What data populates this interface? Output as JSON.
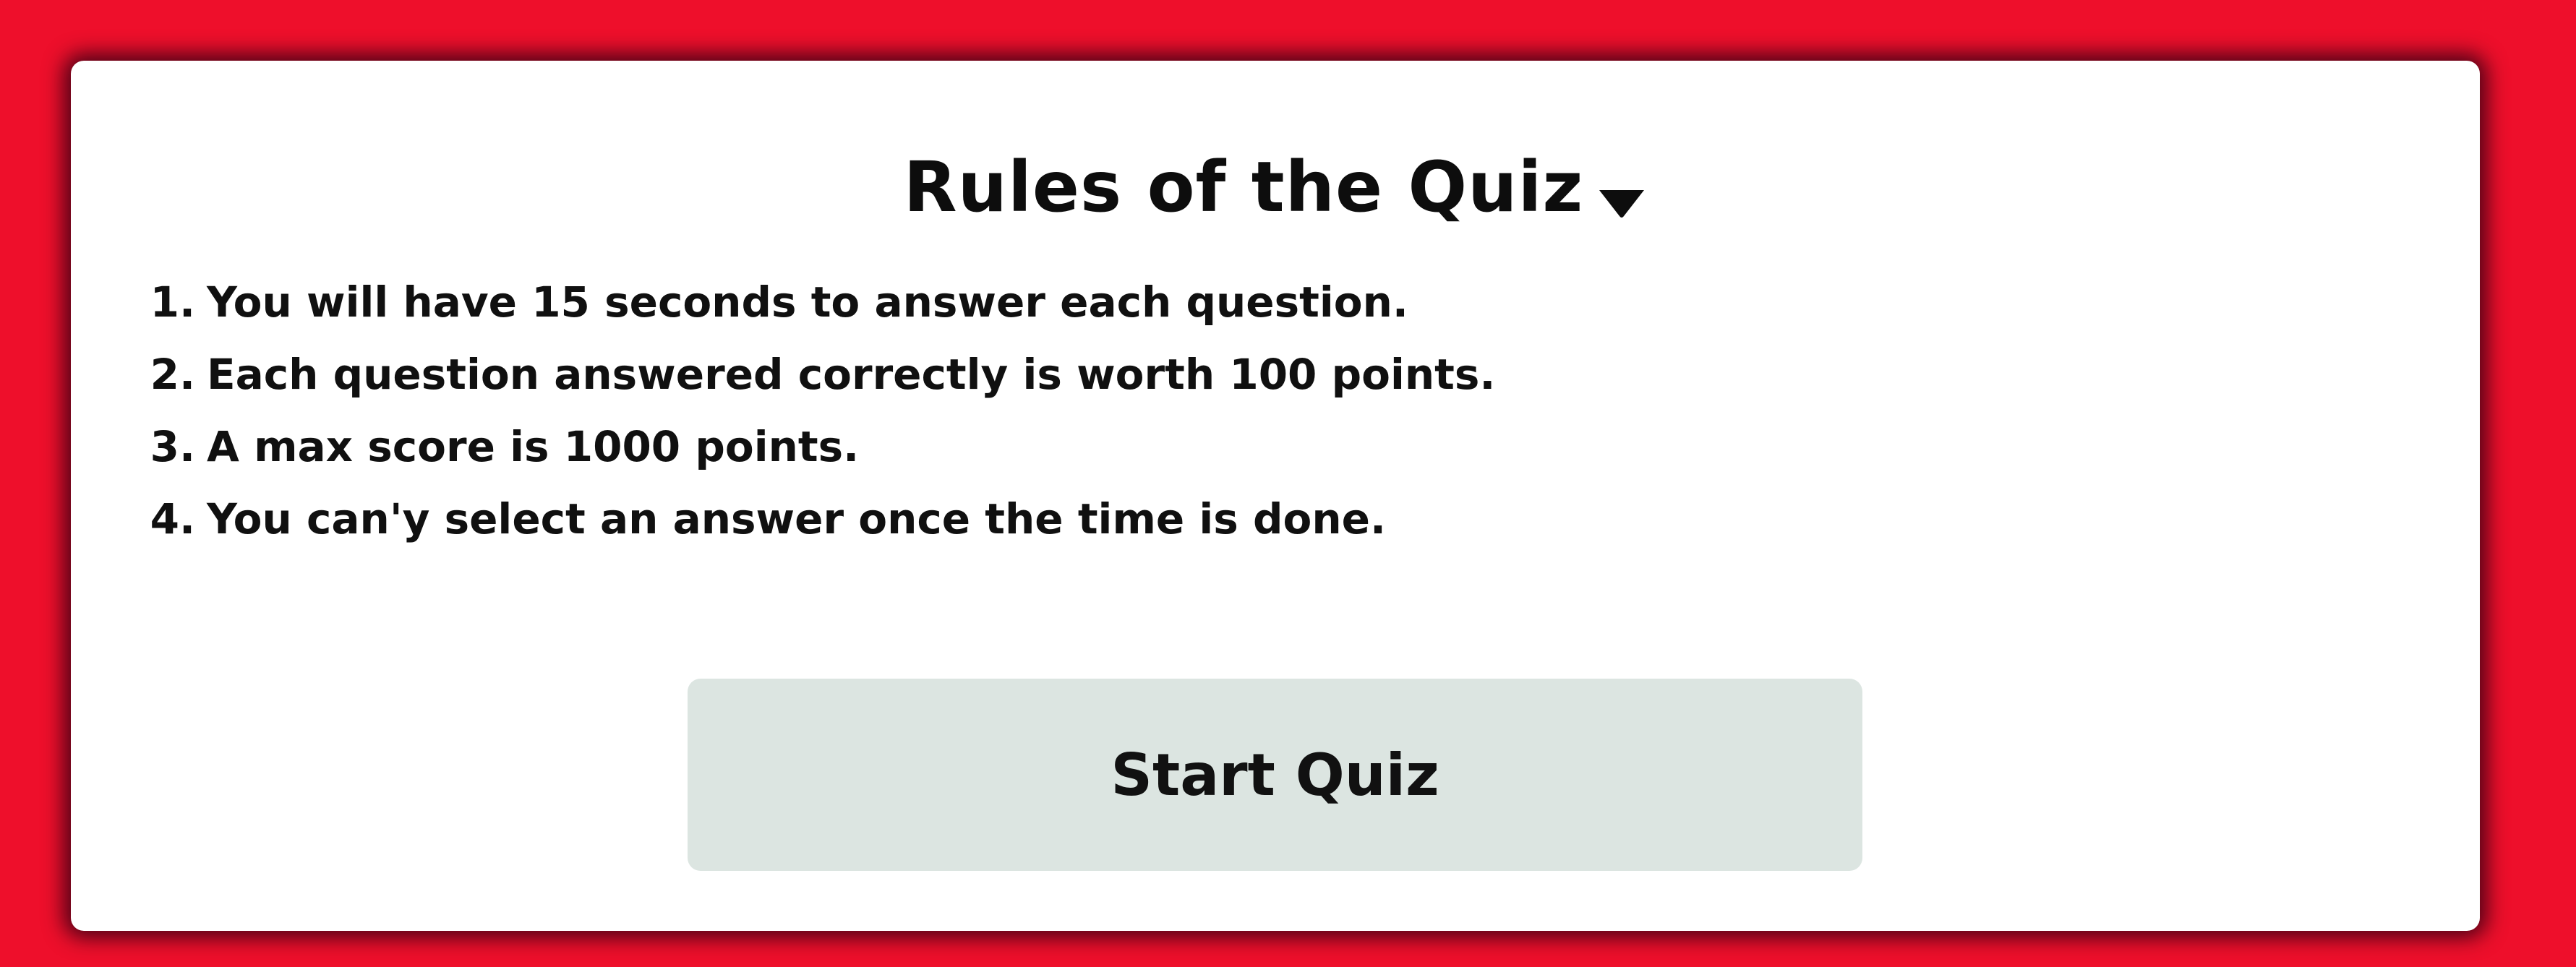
{
  "colors": {
    "background": "#ee0f2b",
    "card": "#ffffff",
    "button": "#dce5e1",
    "text": "#101010"
  },
  "header": {
    "title": "Rules of the Quiz",
    "toggle_icon": "caret-down-icon"
  },
  "rules": [
    {
      "num": "1.",
      "text": "You will have 15 seconds to answer each question."
    },
    {
      "num": "2.",
      "text": "Each question answered correctly is worth 100 points."
    },
    {
      "num": "3.",
      "text": "A max score is 1000 points."
    },
    {
      "num": "4.",
      "text": "You can'y select an answer once the time is done."
    }
  ],
  "actions": {
    "start_label": "Start Quiz"
  }
}
